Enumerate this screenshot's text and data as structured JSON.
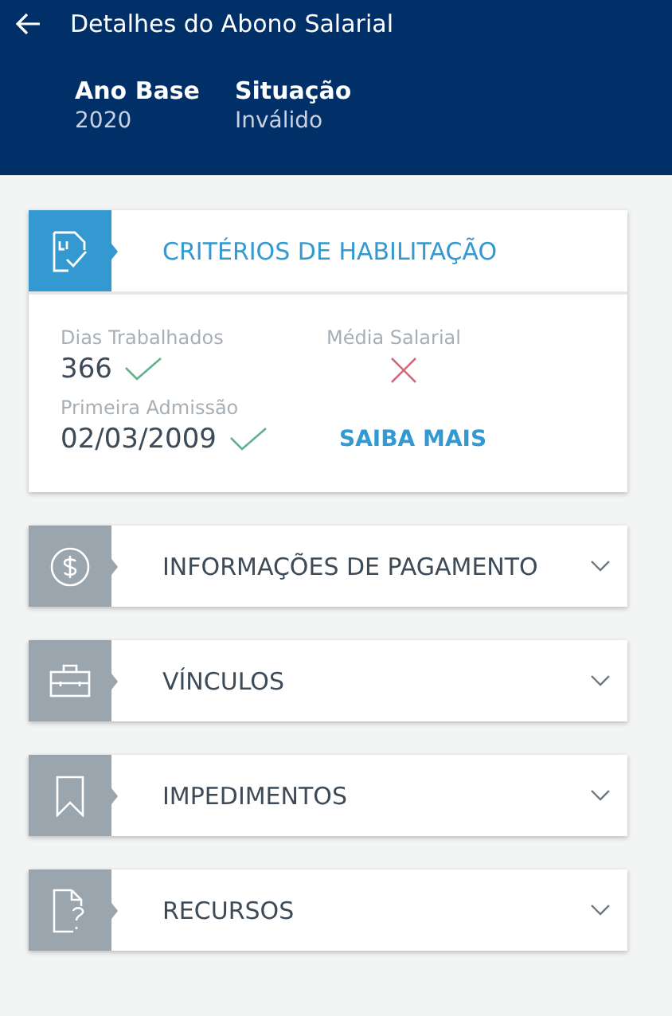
{
  "app_bar": {
    "title": "Detalhes do Abono Salarial"
  },
  "summary": [
    {
      "label": "Ano Base",
      "value": "2020"
    },
    {
      "label": "Situação",
      "value": "Inválido"
    }
  ],
  "sections": [
    {
      "kind": "document-check",
      "title": "CRITÉRIOS DE HABILITAÇÃO",
      "expanded": true,
      "criteria": [
        {
          "label": "Dias Trabalhados",
          "value": "366",
          "met": true
        },
        {
          "label": "Média Salarial",
          "met": false
        },
        {
          "label": "Primeira Admissão",
          "value": "02/03/2009",
          "met": true
        }
      ],
      "link": "SAIBA MAIS"
    },
    {
      "kind": "dollar",
      "title": "INFORMAÇÕES DE PAGAMENTO",
      "expanded": false
    },
    {
      "kind": "briefcase",
      "title": "VÍNCULOS",
      "expanded": false
    },
    {
      "kind": "bookmark",
      "title": "IMPEDIMENTOS",
      "expanded": false
    },
    {
      "kind": "document-question",
      "title": "RECURSOS",
      "expanded": false
    }
  ]
}
